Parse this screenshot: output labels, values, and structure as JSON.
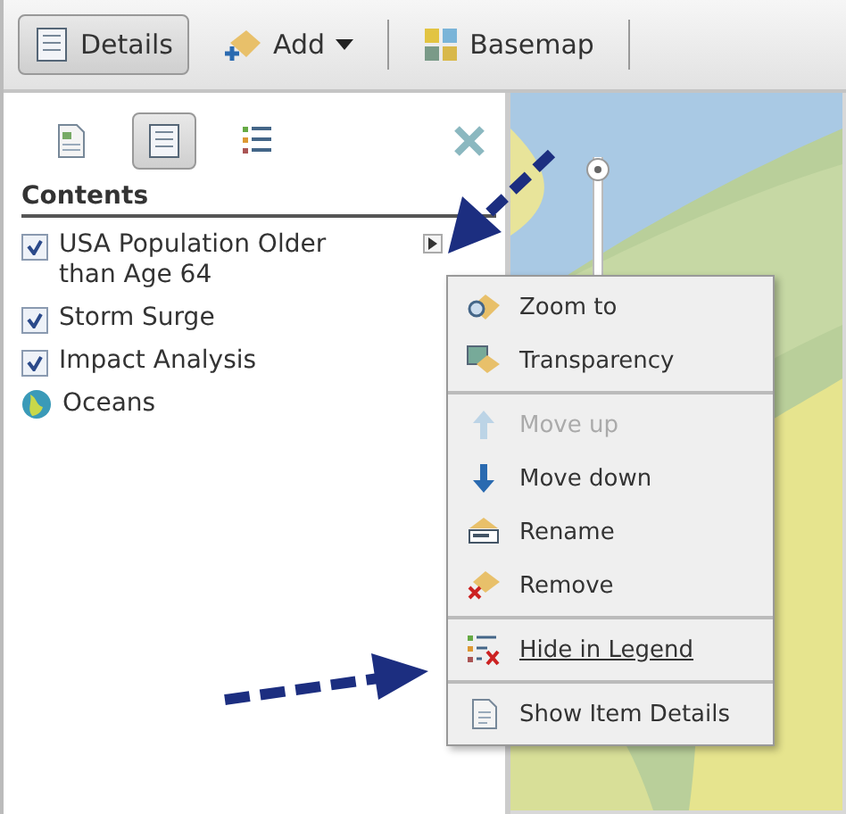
{
  "toolbar": {
    "buttons": [
      {
        "label": "Details",
        "kind": "details",
        "selected": true
      },
      {
        "label": "Add",
        "kind": "add",
        "selected": false,
        "dropdown": true
      },
      {
        "label": "Basemap",
        "kind": "basemap",
        "selected": false,
        "dropdown": false
      }
    ]
  },
  "panel": {
    "view_buttons": [
      {
        "kind": "about",
        "selected": false
      },
      {
        "kind": "contents",
        "selected": true
      },
      {
        "kind": "legend",
        "selected": false
      }
    ],
    "heading": "Contents",
    "layers": [
      {
        "name": "USA Population Older than Age 64",
        "kind": "checkbox",
        "checked": true,
        "menu_open": true
      },
      {
        "name": "Storm Surge",
        "kind": "checkbox",
        "checked": true,
        "menu_open": false
      },
      {
        "name": "Impact Analysis",
        "kind": "checkbox",
        "checked": true,
        "menu_open": false
      },
      {
        "name": "Oceans",
        "kind": "basemap",
        "menu_open": false
      }
    ]
  },
  "map": {
    "zoom_slider": {
      "level": 1
    }
  },
  "context_menu": {
    "groups": [
      [
        {
          "label": "Zoom to",
          "disabled": false,
          "hovered": false
        },
        {
          "label": "Transparency",
          "disabled": false,
          "hovered": false
        }
      ],
      [
        {
          "label": "Move up",
          "disabled": true,
          "hovered": false
        },
        {
          "label": "Move down",
          "disabled": false,
          "hovered": false
        },
        {
          "label": "Rename",
          "disabled": false,
          "hovered": false
        },
        {
          "label": "Remove",
          "disabled": false,
          "hovered": false
        }
      ],
      [
        {
          "label": "Hide in Legend",
          "disabled": false,
          "hovered": true
        }
      ],
      [
        {
          "label": "Show Item Details",
          "disabled": false,
          "hovered": false
        }
      ]
    ]
  }
}
